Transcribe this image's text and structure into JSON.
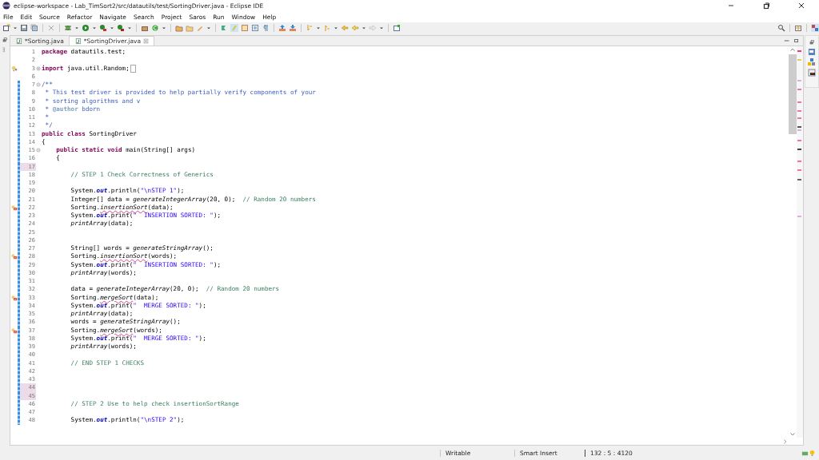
{
  "window": {
    "title": "eclipse-workspace - Lab_TimSort2/src/datautils/test/SortingDriver.java - Eclipse IDE"
  },
  "menu": [
    "File",
    "Edit",
    "Source",
    "Refactor",
    "Navigate",
    "Search",
    "Project",
    "Saros",
    "Run",
    "Window",
    "Help"
  ],
  "tabs": [
    {
      "label": "*Sorting.java",
      "selected": false
    },
    {
      "label": "*SortingDriver.java",
      "selected": true
    }
  ],
  "editor": {
    "lines": [
      {
        "number": "1",
        "changed": false,
        "highlighted": false,
        "segments": [
          {
            "kind": "keyword",
            "text": "package"
          },
          {
            "kind": "plain",
            "text": " datautils.test;"
          }
        ]
      },
      {
        "number": "2",
        "changed": false,
        "highlighted": false
      },
      {
        "number": "3",
        "changed": false,
        "highlighted": false,
        "fold": {
          "expanded": false
        },
        "annotation": {
          "kind": "warning"
        },
        "segments": [
          {
            "kind": "keyword",
            "text": "import"
          },
          {
            "kind": "plain",
            "text": " java.util.Random;"
          }
        ]
      },
      {
        "number": "6",
        "changed": false,
        "highlighted": false
      },
      {
        "number": "7",
        "changed": true,
        "highlighted": false,
        "fold": {
          "expanded": true
        },
        "segments": [
          {
            "kind": "doc",
            "text": "/**"
          }
        ]
      },
      {
        "number": "8",
        "changed": true,
        "highlighted": false,
        "segments": [
          {
            "kind": "doc",
            "text": " * This test driver is provided to help partially verify components of your"
          }
        ]
      },
      {
        "number": "9",
        "changed": true,
        "highlighted": false,
        "segments": [
          {
            "kind": "doc",
            "text": " * sorting algorithms and v"
          }
        ]
      },
      {
        "number": "10",
        "changed": true,
        "highlighted": false,
        "segments": [
          {
            "kind": "doc",
            "text": " * "
          },
          {
            "kind": "doctag",
            "text": "@author"
          },
          {
            "kind": "doc",
            "text": " bdorn"
          }
        ]
      },
      {
        "number": "11",
        "changed": true,
        "highlighted": false,
        "segments": [
          {
            "kind": "doc",
            "text": " *"
          }
        ]
      },
      {
        "number": "12",
        "changed": true,
        "highlighted": false,
        "segments": [
          {
            "kind": "doc",
            "text": " */"
          }
        ]
      },
      {
        "number": "13",
        "changed": true,
        "highlighted": false,
        "segments": [
          {
            "kind": "keyword",
            "text": "public class"
          },
          {
            "kind": "plain",
            "text": " SortingDriver"
          }
        ]
      },
      {
        "number": "14",
        "changed": true,
        "highlighted": false,
        "segments": [
          {
            "kind": "plain",
            "text": "{"
          }
        ]
      },
      {
        "number": "15",
        "changed": true,
        "highlighted": false,
        "fold": {
          "expanded": true
        },
        "segments": [
          {
            "kind": "keyword",
            "text": "    public static void"
          },
          {
            "kind": "plain",
            "text": " main(String[] args)"
          }
        ]
      },
      {
        "number": "16",
        "changed": true,
        "highlighted": false,
        "segments": [
          {
            "kind": "plain",
            "text": "    {"
          }
        ]
      },
      {
        "number": "17",
        "changed": true,
        "highlighted": true
      },
      {
        "number": "18",
        "changed": true,
        "highlighted": false,
        "segments": [
          {
            "kind": "comment",
            "text": "        // STEP 1 Check Correctness of Generics"
          }
        ]
      },
      {
        "number": "19",
        "changed": true,
        "highlighted": false
      },
      {
        "number": "20",
        "changed": true,
        "highlighted": false,
        "segments": [
          {
            "kind": "plain",
            "text": "        System."
          },
          {
            "kind": "field",
            "text": "out"
          },
          {
            "kind": "plain",
            "text": ".println("
          },
          {
            "kind": "string",
            "text": "\"\\nSTEP 1\""
          },
          {
            "kind": "plain",
            "text": ");"
          }
        ]
      },
      {
        "number": "21",
        "changed": true,
        "highlighted": false,
        "segments": [
          {
            "kind": "plain",
            "text": "        Integer[] data = "
          },
          {
            "kind": "static",
            "text": "generateIntegerArray"
          },
          {
            "kind": "plain",
            "text": "(20, 0);  "
          },
          {
            "kind": "comment",
            "text": "// Random 20 numbers"
          }
        ]
      },
      {
        "number": "22",
        "changed": true,
        "highlighted": false,
        "annotation": {
          "kind": "error"
        },
        "segments": [
          {
            "kind": "plain",
            "text": "        Sorting."
          },
          {
            "kind": "error",
            "text": "insertionSort"
          },
          {
            "kind": "plain",
            "text": "(data);"
          }
        ]
      },
      {
        "number": "23",
        "changed": true,
        "highlighted": false,
        "segments": [
          {
            "kind": "plain",
            "text": "        System."
          },
          {
            "kind": "field",
            "text": "out"
          },
          {
            "kind": "plain",
            "text": ".print("
          },
          {
            "kind": "string",
            "text": "\"  INSERTION SORTED: \""
          },
          {
            "kind": "plain",
            "text": ");"
          }
        ]
      },
      {
        "number": "24",
        "changed": true,
        "highlighted": false,
        "segments": [
          {
            "kind": "static",
            "text": "        printArray"
          },
          {
            "kind": "plain",
            "text": "(data);"
          }
        ]
      },
      {
        "number": "25",
        "changed": true,
        "highlighted": false
      },
      {
        "number": "26",
        "changed": true,
        "highlighted": false
      },
      {
        "number": "27",
        "changed": true,
        "highlighted": false,
        "segments": [
          {
            "kind": "plain",
            "text": "        String[] words = "
          },
          {
            "kind": "static",
            "text": "generateStringArray"
          },
          {
            "kind": "plain",
            "text": "();"
          }
        ]
      },
      {
        "number": "28",
        "changed": true,
        "highlighted": false,
        "annotation": {
          "kind": "error"
        },
        "segments": [
          {
            "kind": "plain",
            "text": "        Sorting."
          },
          {
            "kind": "error",
            "text": "insertionSort"
          },
          {
            "kind": "plain",
            "text": "(words);"
          }
        ]
      },
      {
        "number": "29",
        "changed": true,
        "highlighted": false,
        "segments": [
          {
            "kind": "plain",
            "text": "        System."
          },
          {
            "kind": "field",
            "text": "out"
          },
          {
            "kind": "plain",
            "text": ".print("
          },
          {
            "kind": "string",
            "text": "\"  INSERTION SORTED: \""
          },
          {
            "kind": "plain",
            "text": ");"
          }
        ]
      },
      {
        "number": "30",
        "changed": true,
        "highlighted": false,
        "segments": [
          {
            "kind": "static",
            "text": "        printArray"
          },
          {
            "kind": "plain",
            "text": "(words);"
          }
        ]
      },
      {
        "number": "31",
        "changed": true,
        "highlighted": false
      },
      {
        "number": "32",
        "changed": true,
        "highlighted": false,
        "segments": [
          {
            "kind": "plain",
            "text": "        data = "
          },
          {
            "kind": "static",
            "text": "generateIntegerArray"
          },
          {
            "kind": "plain",
            "text": "(20, 0);  "
          },
          {
            "kind": "comment",
            "text": "// Random 20 numbers"
          }
        ]
      },
      {
        "number": "33",
        "changed": true,
        "highlighted": false,
        "annotation": {
          "kind": "error"
        },
        "segments": [
          {
            "kind": "plain",
            "text": "        Sorting."
          },
          {
            "kind": "error",
            "text": "mergeSort"
          },
          {
            "kind": "plain",
            "text": "(data);"
          }
        ]
      },
      {
        "number": "34",
        "changed": true,
        "highlighted": false,
        "segments": [
          {
            "kind": "plain",
            "text": "        System."
          },
          {
            "kind": "field",
            "text": "out"
          },
          {
            "kind": "plain",
            "text": ".print("
          },
          {
            "kind": "string",
            "text": "\"  MERGE SORTED: \""
          },
          {
            "kind": "plain",
            "text": ");"
          }
        ]
      },
      {
        "number": "35",
        "changed": true,
        "highlighted": false,
        "segments": [
          {
            "kind": "static",
            "text": "        printArray"
          },
          {
            "kind": "plain",
            "text": "(data);"
          }
        ]
      },
      {
        "number": "36",
        "changed": true,
        "highlighted": false,
        "segments": [
          {
            "kind": "plain",
            "text": "        words = "
          },
          {
            "kind": "static",
            "text": "generateStringArray"
          },
          {
            "kind": "plain",
            "text": "();"
          }
        ]
      },
      {
        "number": "37",
        "changed": true,
        "highlighted": false,
        "annotation": {
          "kind": "error"
        },
        "segments": [
          {
            "kind": "plain",
            "text": "        Sorting."
          },
          {
            "kind": "error",
            "text": "mergeSort"
          },
          {
            "kind": "plain",
            "text": "(words);"
          }
        ]
      },
      {
        "number": "38",
        "changed": true,
        "highlighted": false,
        "segments": [
          {
            "kind": "plain",
            "text": "        System."
          },
          {
            "kind": "field",
            "text": "out"
          },
          {
            "kind": "plain",
            "text": ".print("
          },
          {
            "kind": "string",
            "text": "\"  MERGE SORTED: \""
          },
          {
            "kind": "plain",
            "text": ");"
          }
        ]
      },
      {
        "number": "39",
        "changed": true,
        "highlighted": false,
        "segments": [
          {
            "kind": "static",
            "text": "        printArray"
          },
          {
            "kind": "plain",
            "text": "(words);"
          }
        ]
      },
      {
        "number": "40",
        "changed": true,
        "highlighted": false
      },
      {
        "number": "41",
        "changed": true,
        "highlighted": false,
        "segments": [
          {
            "kind": "comment",
            "text": "        // END STEP 1 CHECKS"
          }
        ]
      },
      {
        "number": "42",
        "changed": true,
        "highlighted": false
      },
      {
        "number": "43",
        "changed": true,
        "highlighted": false
      },
      {
        "number": "44",
        "changed": true,
        "highlighted": true
      },
      {
        "number": "45",
        "changed": true,
        "highlighted": true
      },
      {
        "number": "46",
        "changed": true,
        "highlighted": false,
        "segments": [
          {
            "kind": "comment",
            "text": "        // STEP 2 Use to help check insertionSortRange"
          }
        ]
      },
      {
        "number": "47",
        "changed": true,
        "highlighted": false
      },
      {
        "number": "48",
        "changed": true,
        "highlighted": false,
        "segments": [
          {
            "kind": "plain",
            "text": "        System."
          },
          {
            "kind": "field",
            "text": "out"
          },
          {
            "kind": "plain",
            "text": ".println("
          },
          {
            "kind": "string",
            "text": "\"\\nSTEP 2\""
          },
          {
            "kind": "plain",
            "text": ");"
          }
        ]
      }
    ]
  },
  "status_bar": {
    "mode": "Writable",
    "insert_mode": "Smart Insert",
    "position": "132 : 5 : 4120"
  }
}
